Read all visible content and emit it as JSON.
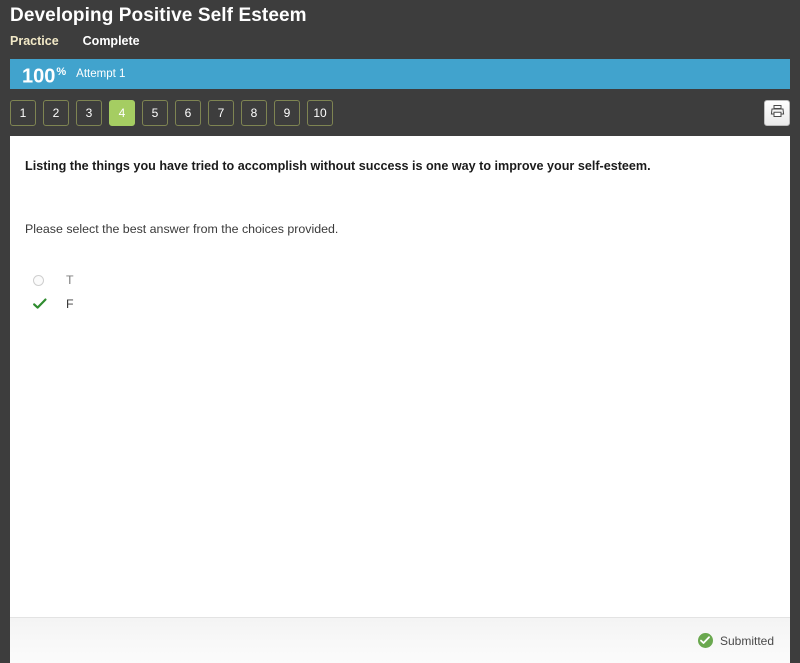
{
  "header": {
    "course_title": "Developing Positive Self Esteem",
    "mode_tabs": [
      {
        "label": "Practice",
        "active": true
      },
      {
        "label": "Complete",
        "active": false
      }
    ]
  },
  "progress": {
    "percent": "100",
    "percent_symbol": "%",
    "attempt": "Attempt 1",
    "bar_color": "#41a3cd"
  },
  "question_nav": {
    "items": [
      {
        "label": "1",
        "current": false
      },
      {
        "label": "2",
        "current": false
      },
      {
        "label": "3",
        "current": false
      },
      {
        "label": "4",
        "current": true
      },
      {
        "label": "5",
        "current": false
      },
      {
        "label": "6",
        "current": false
      },
      {
        "label": "7",
        "current": false
      },
      {
        "label": "8",
        "current": false
      },
      {
        "label": "9",
        "current": false
      },
      {
        "label": "10",
        "current": false
      }
    ],
    "current_color": "#a5cd62",
    "border_color": "#7e8452",
    "print_icon": "printer-icon"
  },
  "question": {
    "stem": "Listing the things you have tried to accomplish without success is one way to improve your self-esteem.",
    "instruction": "Please select the best answer from the choices provided.",
    "choices": [
      {
        "label": "T",
        "marker": "radio-unselected-icon",
        "selected": false
      },
      {
        "label": "F",
        "marker": "green-check-icon",
        "selected": true
      }
    ]
  },
  "footer": {
    "status_icon": "check-circle-icon",
    "status_label": "Submitted",
    "status_color": "#6aa84f"
  }
}
